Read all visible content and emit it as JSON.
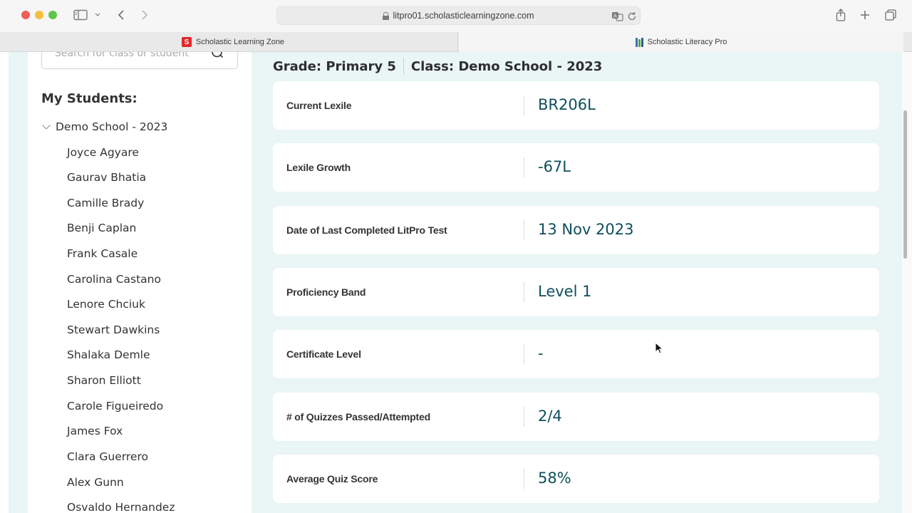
{
  "browser": {
    "address": "litpro01.scholasticlearningzone.com",
    "tabs": [
      {
        "label": "Scholastic Learning Zone",
        "favicon_letter": "S"
      },
      {
        "label": "Scholastic Literacy Pro"
      }
    ]
  },
  "sidebar": {
    "search_placeholder": "Search for class or student",
    "heading": "My Students:",
    "class_name": "Demo School - 2023",
    "students": [
      "Joyce Agyare",
      "Gaurav Bhatia",
      "Camille Brady",
      "Benji Caplan",
      "Frank Casale",
      "Carolina Castano",
      "Lenore Chciuk",
      "Stewart Dawkins",
      "Shalaka Demle",
      "Sharon Elliott",
      "Carole Figueiredo",
      "James Fox",
      "Clara Guerrero",
      "Alex Gunn",
      "Osvaldo Hernandez"
    ]
  },
  "main": {
    "grade": "Grade: Primary 5",
    "class": "Class: Demo School - 2023",
    "stats": [
      {
        "label": "Current Lexile",
        "value": "BR206L"
      },
      {
        "label": "Lexile Growth",
        "value": "-67L"
      },
      {
        "label": "Date of Last Completed LitPro Test",
        "value": "13 Nov 2023"
      },
      {
        "label": "Proficiency Band",
        "value": "Level 1"
      },
      {
        "label": "Certificate Level",
        "value": "-"
      },
      {
        "label": "# of Quizzes Passed/Attempted",
        "value": "2/4"
      },
      {
        "label": "Average Quiz Score",
        "value": "58%"
      }
    ]
  },
  "colors": {
    "page_bg": "#eaf5f5",
    "value_text": "#0e4f5c",
    "brand_red": "#e4262b"
  }
}
